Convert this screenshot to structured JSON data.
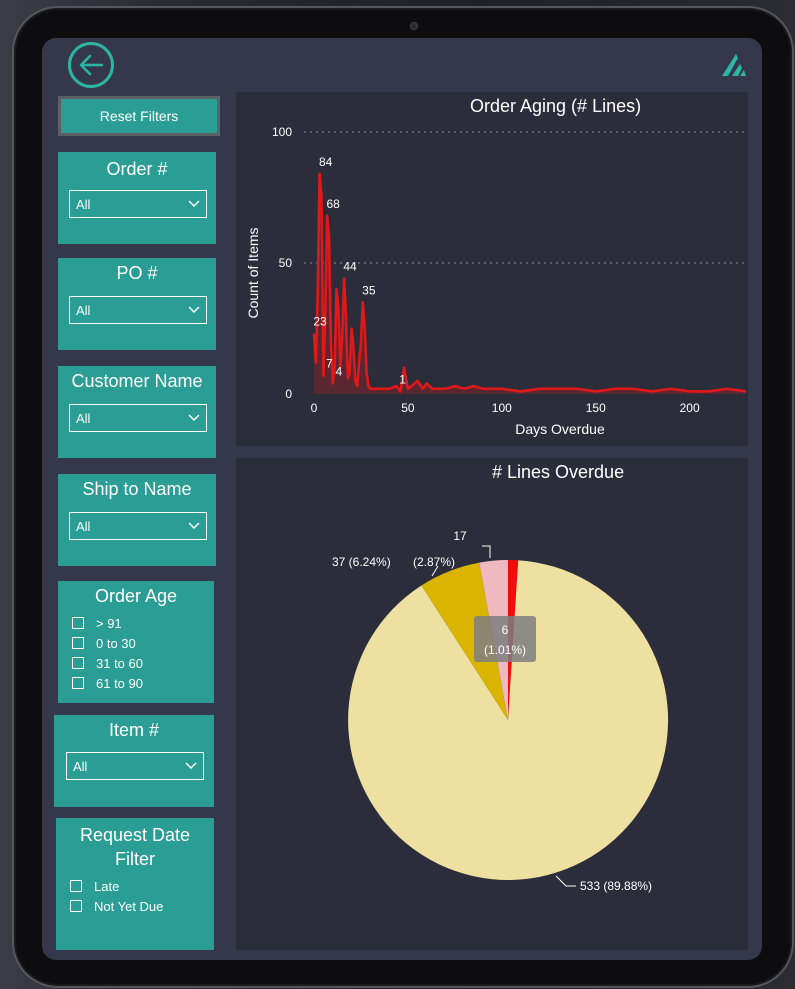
{
  "reset_label": "Reset Filters",
  "filters": {
    "order": {
      "title": "Order #",
      "value": "All"
    },
    "po": {
      "title": "PO #",
      "value": "All"
    },
    "customer": {
      "title": "Customer Name",
      "value": "All"
    },
    "shipto": {
      "title": "Ship to Name",
      "value": "All"
    },
    "order_age": {
      "title": "Order Age",
      "options": [
        "> 91",
        "0 to 30",
        "31 to 60",
        "61 to 90"
      ]
    },
    "item": {
      "title": "Item #",
      "value": "All"
    },
    "request_date": {
      "title_line1": "Request Date",
      "title_line2": "Filter",
      "options": [
        "Late",
        "Not Yet Due"
      ]
    }
  },
  "colors": {
    "teal": "#2a9d94",
    "line": "#e01818",
    "pie_main": "#ede0a0",
    "pie_gold": "#d9b400",
    "pie_pink": "#f0b8bf",
    "pie_red": "#f20d0d"
  },
  "chart_data": [
    {
      "type": "area",
      "title": "Order Aging (# Lines)",
      "xlabel": "Days Overdue",
      "ylabel": "Count of Items",
      "xlim": [
        0,
        230
      ],
      "ylim": [
        0,
        100
      ],
      "xticks": [
        "0",
        "50",
        "100",
        "150",
        "200"
      ],
      "yticks": [
        "0",
        "50",
        "100"
      ],
      "grid": "horizontal dotted",
      "x": [
        0,
        1,
        2,
        3,
        4,
        5,
        6,
        7,
        8,
        9,
        10,
        11,
        12,
        13,
        14,
        15,
        16,
        17,
        18,
        19,
        20,
        21,
        22,
        23,
        24,
        25,
        26,
        27,
        28,
        29,
        30,
        32,
        35,
        40,
        44,
        46,
        48,
        50,
        52,
        55,
        58,
        60,
        63,
        67,
        70,
        75,
        80,
        85,
        90,
        100,
        110,
        120,
        130,
        140,
        150,
        160,
        170,
        180,
        190,
        200,
        210,
        220,
        230
      ],
      "values": [
        23,
        12,
        40,
        84,
        75,
        7,
        30,
        68,
        60,
        20,
        4,
        10,
        40,
        33,
        10,
        22,
        44,
        30,
        6,
        8,
        25,
        18,
        5,
        3,
        12,
        20,
        35,
        25,
        8,
        3,
        2,
        2,
        2,
        2,
        3,
        1,
        10,
        2,
        3,
        5,
        2,
        4,
        2,
        2,
        2,
        3,
        2,
        3,
        2,
        2,
        1,
        2,
        2,
        2,
        1,
        2,
        2,
        1,
        2,
        1,
        1,
        2,
        1
      ],
      "data_labels": [
        {
          "x": 0,
          "value": 23,
          "text": "23"
        },
        {
          "x": 3,
          "value": 84,
          "text": "84"
        },
        {
          "x": 5,
          "value": 7,
          "text": "7"
        },
        {
          "x": 7,
          "value": 68,
          "text": "68"
        },
        {
          "x": 10,
          "value": 4,
          "text": "4"
        },
        {
          "x": 16,
          "value": 44,
          "text": "44"
        },
        {
          "x": 26,
          "value": 35,
          "text": "35"
        },
        {
          "x": 44,
          "value": 1,
          "text": "1"
        }
      ]
    },
    {
      "type": "pie",
      "title": "# Lines Overdue",
      "slices": [
        {
          "value": 6,
          "label_line1": "6",
          "label_line2": "(1.01%)",
          "color": "#f20d0d"
        },
        {
          "value": 533,
          "label": "533 (89.88%)",
          "color": "#ede0a0"
        },
        {
          "value": 37,
          "label": "37 (6.24%)",
          "color": "#d9b400"
        },
        {
          "value": 17,
          "label_line1": "17",
          "label_line2": "(2.87%)",
          "color": "#f0b8bf"
        }
      ]
    }
  ]
}
